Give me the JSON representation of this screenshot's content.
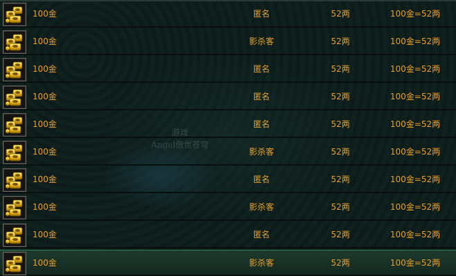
{
  "watermark": {
    "line1": "游戏",
    "line2": "Angel傲世苍穹"
  },
  "rows": [
    {
      "icon": "gold-ingot-icon",
      "item": "100金",
      "seller": "匿名",
      "price": "52两",
      "rate": "100金=52两"
    },
    {
      "icon": "gold-ingot-icon",
      "item": "100金",
      "seller": "影杀客",
      "price": "52两",
      "rate": "100金=52两"
    },
    {
      "icon": "gold-ingot-icon",
      "item": "100金",
      "seller": "匿名",
      "price": "52两",
      "rate": "100金=52两"
    },
    {
      "icon": "gold-ingot-icon",
      "item": "100金",
      "seller": "匿名",
      "price": "52两",
      "rate": "100金=52两"
    },
    {
      "icon": "gold-ingot-icon",
      "item": "100金",
      "seller": "匿名",
      "price": "52两",
      "rate": "100金=52两"
    },
    {
      "icon": "gold-ingot-icon",
      "item": "100金",
      "seller": "影杀客",
      "price": "52两",
      "rate": "100金=52两"
    },
    {
      "icon": "gold-ingot-icon",
      "item": "100金",
      "seller": "匿名",
      "price": "52两",
      "rate": "100金=52两"
    },
    {
      "icon": "gold-ingot-icon",
      "item": "100金",
      "seller": "影杀客",
      "price": "52两",
      "rate": "100金=52两"
    },
    {
      "icon": "gold-ingot-icon",
      "item": "100金",
      "seller": "匿名",
      "price": "52两",
      "rate": "100金=52两"
    },
    {
      "icon": "gold-ingot-icon",
      "item": "100金",
      "seller": "影杀客",
      "price": "52两",
      "rate": "100金=52两"
    }
  ],
  "selected_row": 9,
  "colors": {
    "text": "#e8a028",
    "background": "#0c1a18",
    "selected_row": "#1d3a2e",
    "gold": "#f0c020"
  }
}
